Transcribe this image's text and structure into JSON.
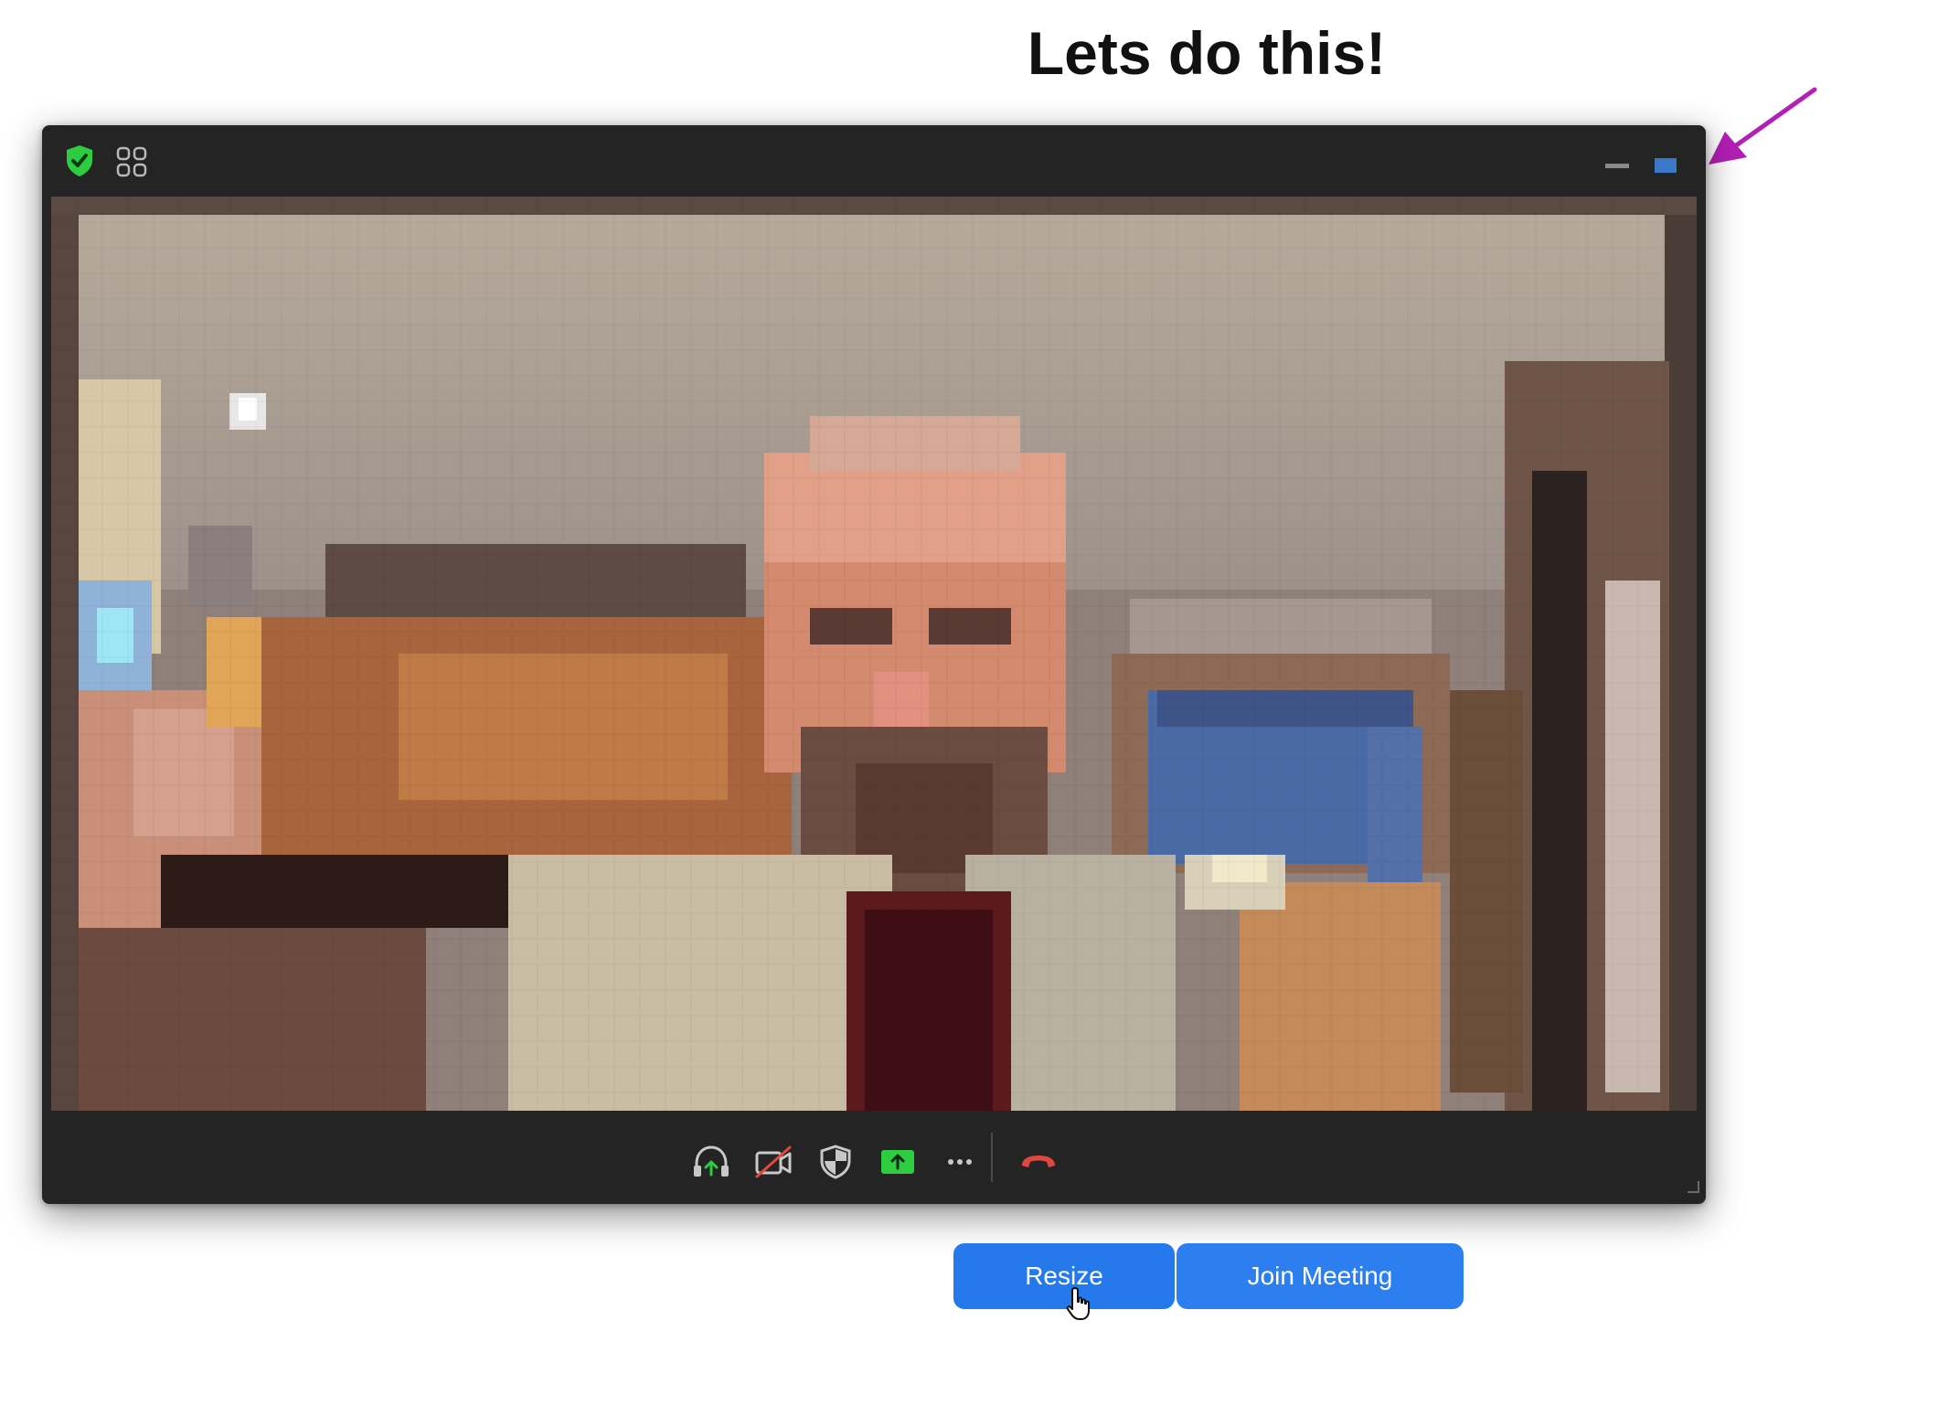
{
  "heading": "Lets do this!",
  "annotation": {
    "arrow_color": "#b41fb5"
  },
  "window": {
    "titlebar": {
      "security_icon": "shield-check-icon",
      "view_icon": "grid-view-icon",
      "minimize_icon": "minimize-icon",
      "fullscreen_icon": "fullscreen-icon",
      "security_color": "#2ecc40",
      "fullscreen_color": "#3a78c9"
    },
    "video": {
      "content": "pixelated-participant-video"
    },
    "controls": [
      {
        "name": "audio-headphones-icon"
      },
      {
        "name": "video-off-icon"
      },
      {
        "name": "security-shield-icon"
      },
      {
        "name": "share-screen-icon"
      },
      {
        "name": "more-icon"
      },
      {
        "name": "leave-call-icon"
      }
    ]
  },
  "buttons": {
    "resize_label": "Resize",
    "join_label": "Join Meeting",
    "color": "#2d7ff0"
  }
}
